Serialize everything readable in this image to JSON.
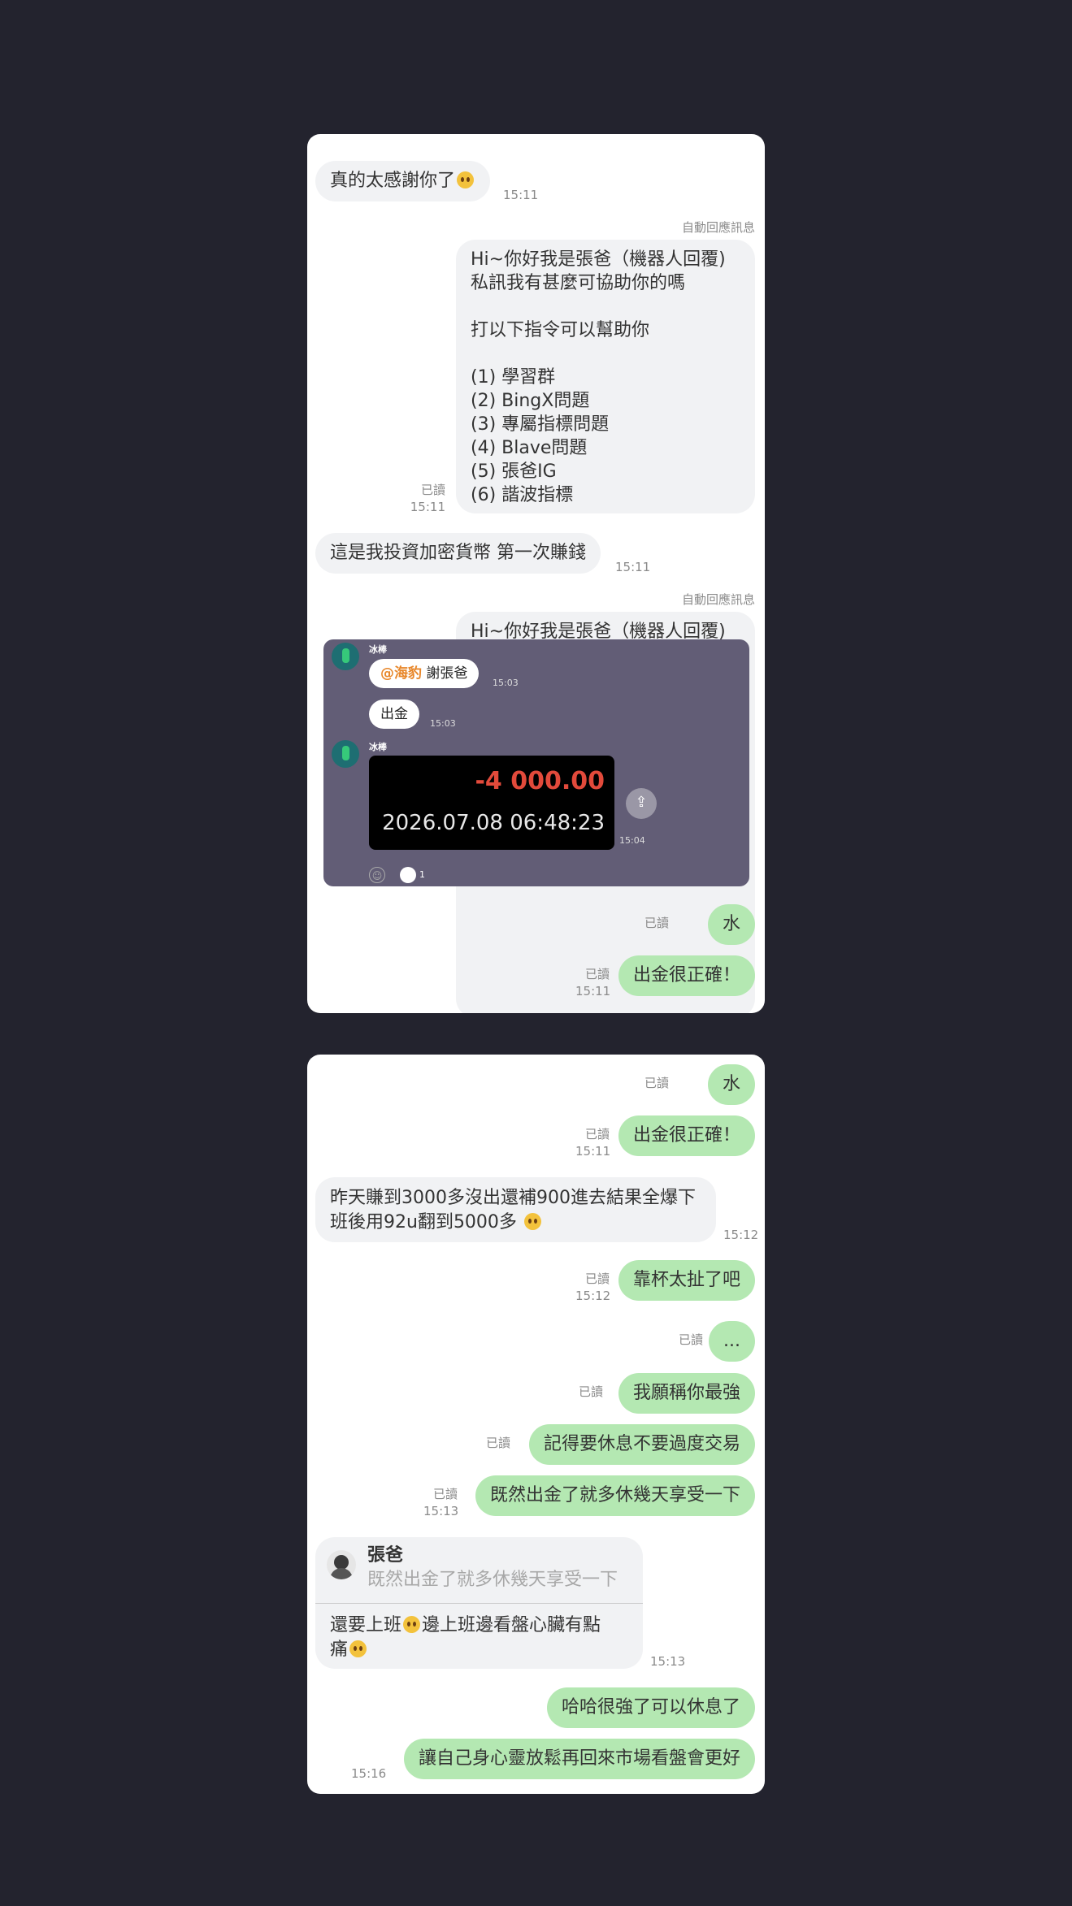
{
  "panel1": {
    "msg_thanks": "真的太感謝你了",
    "time_1511": "15:11",
    "auto_reply_label": "自動回應訊息",
    "bot_reply_lines": [
      "Hi~你好我是張爸（機器人回覆)",
      "私訊我有甚麼可協助你的嗎",
      "",
      "打以下指令可以幫助你",
      "",
      "(1) 學習群",
      "(2) BingX問題",
      "(3) 專屬指標問題",
      "(4) Blave問題",
      "(5) 張爸IG",
      "(6) 諧波指標"
    ],
    "read_label": "已讀",
    "msg_first_profit": "這是我投資加密貨幣 第一次賺錢",
    "bot_reply_partial": "Hi~你好我是張爸（機器人回覆)",
    "screenshot": {
      "sender_name": "冰棒",
      "mention": "@海豹",
      "thanks_text": "謝張爸",
      "time_1503": "15:03",
      "withdraw_text": "出金",
      "amount": "-4 000.00",
      "datetime": "2026.07.08 06:48:23",
      "time_1504": "15:04",
      "reaction_count": "1"
    },
    "msg_water": "水",
    "msg_correct": "出金很正確！"
  },
  "panel2": {
    "msg_water": "水",
    "msg_correct": "出金很正確！",
    "time_1511": "15:11",
    "msg_story_line1": "昨天賺到3000多沒出還補900進去結果全爆下",
    "msg_story_line2": "班後用92u翻到5000多",
    "time_1512": "15:12",
    "msg_cup": "靠杯太扯了吧",
    "msg_dots": "...",
    "msg_strong": "我願稱你最強",
    "msg_rest": "記得要休息不要過度交易",
    "msg_enjoy": "既然出金了就多休幾天享受一下",
    "time_1513": "15:13",
    "reply_name": "張爸",
    "reply_quote": "既然出金了就多休幾天享受一下",
    "reply_line1_a": "還要上班",
    "reply_line1_b": "邊上班邊看盤心臟有點",
    "reply_line2": "痛",
    "msg_haha": "哈哈很強了可以休息了",
    "msg_relax": "讓自己身心靈放鬆再回來市場看盤會更好",
    "time_1516": "15:16",
    "read_label": "已讀"
  }
}
